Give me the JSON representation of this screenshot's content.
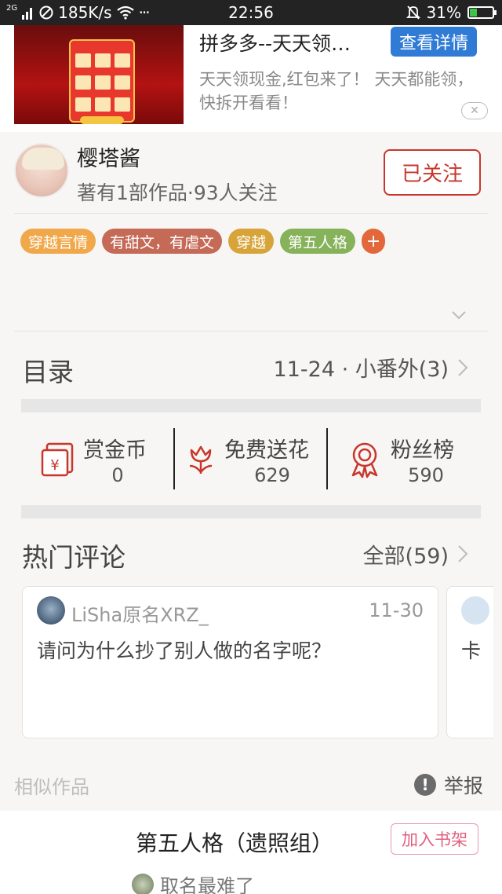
{
  "status_bar": {
    "network": "2G",
    "speed": "185K/s",
    "time": "22:56",
    "battery": "31%",
    "battery_level": 0.31,
    "more": "···"
  },
  "ad": {
    "title": "拼多多--天天领…",
    "button": "查看详情",
    "description": "天天领现金,红包来了！ 天天都能领，快拆开看看！",
    "close": "✕"
  },
  "author": {
    "name": "樱塔酱",
    "meta": "著有1部作品·93人关注",
    "follow_label": "已关注"
  },
  "tags": [
    {
      "label": "穿越言情",
      "color": "#f0a84b"
    },
    {
      "label": "有甜文，有虐文",
      "color": "#c46a56"
    },
    {
      "label": "穿越",
      "color": "#d7a43a"
    },
    {
      "label": "第五人格",
      "color": "#86b25a"
    }
  ],
  "tag_add": "+",
  "tag_add_color": "#e2683c",
  "toc": {
    "label": "目录",
    "latest": "11-24 · 小番外(3)"
  },
  "stats": [
    {
      "label": "赏金币",
      "value": "0",
      "icon": "red-envelope-icon"
    },
    {
      "label": "免费送花",
      "value": "629",
      "icon": "flower-icon"
    },
    {
      "label": "粉丝榜",
      "value": "590",
      "icon": "medal-icon"
    }
  ],
  "comments": {
    "title": "热门评论",
    "all_label": "全部(59)",
    "items": [
      {
        "user": "LiSha原名XRZ_",
        "date": "11-30",
        "text": "请问为什么抄了别人做的名字呢？"
      },
      {
        "text": "卡"
      }
    ]
  },
  "similar_label": "相似作品",
  "report_label": "举报",
  "book": {
    "title": "第五人格（遗照组）",
    "shelf_button": "加入书架",
    "author": "取名最难了"
  },
  "accent": "#c8362b"
}
